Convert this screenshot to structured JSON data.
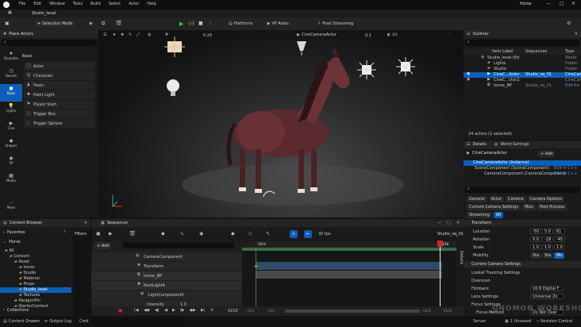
{
  "app": {
    "level_tab": "Studio_level",
    "project_name": "Horse",
    "menu": [
      "File",
      "Edit",
      "Window",
      "Tools",
      "Build",
      "Select",
      "Actor",
      "Help"
    ],
    "toolbar": {
      "mode": "Selection Mode",
      "platforms": "Platforms",
      "vp_roles": "VP Roles",
      "pixel_streaming": "Pixel Streaming"
    }
  },
  "place_actors": {
    "title": "Place Actors",
    "category_tab": "Basic",
    "categories": [
      "Favorites",
      "Recent",
      "Basic",
      "Lights",
      "Cine",
      "Shapes",
      "VP",
      "Media",
      "More"
    ],
    "items": [
      "Actor",
      "Character",
      "Pawn",
      "Point Light",
      "Player Start",
      "Trigger Box",
      "Trigger Sphere"
    ]
  },
  "viewport": {
    "actor_name": "CineCameraActor",
    "fov_value": "0.1",
    "lit_mode": "Lit",
    "snap_value": "0.25",
    "top_angle": "10°",
    "top_scale": "1"
  },
  "outliner": {
    "title": "Outliner",
    "col_label": "Item Label",
    "col_sequences": "Sequences",
    "col_type": "Type",
    "rows": [
      {
        "label": "Studio_level (Ed",
        "seq": "",
        "type": "World"
      },
      {
        "label": "Lights",
        "seq": "",
        "type": "Folder"
      },
      {
        "label": "Studio",
        "seq": "",
        "type": "Folder"
      },
      {
        "label": "CineC...Actor",
        "seq": "Studio_sq_01",
        "type": "CineCam"
      },
      {
        "label": "CineC...ctor2",
        "seq": "",
        "type": "CineCam"
      },
      {
        "label": "horse_BP",
        "seq": "Studio_sq_01",
        "type": "Edit ho"
      }
    ],
    "status": "24 actors (1 selected)"
  },
  "details": {
    "tab_details": "Details",
    "tab_world": "World Settings",
    "actor": "CineCameraActor",
    "add": "+ Add",
    "components": [
      {
        "label": "CineCameraActor (Instance)",
        "link": ""
      },
      {
        "label": "SceneComponent (SceneComponent)",
        "link": "Edit in C++"
      },
      {
        "label": "CameraComponent (CameraComponent)",
        "link": "Edit in C++"
      }
    ],
    "filter_tabs_row1": [
      "General",
      "Actor",
      "Camera",
      "Camera Options"
    ],
    "filter_tabs_row2": [
      "Current Camera Settings",
      "Misc",
      "Post Process"
    ],
    "filter_tabs_row3": [
      "Streaming",
      "All"
    ],
    "transform_title": "Transform",
    "transform": [
      {
        "label": "Location",
        "x": "-50",
        "y": "5.0",
        "z": "61"
      },
      {
        "label": "Rotation",
        "x": "0.0",
        "y": "-18",
        "z": "-45"
      },
      {
        "label": "Scale",
        "x": "1.0",
        "y": "1.0",
        "z": "1.0"
      }
    ],
    "mobility": {
      "label": "Mobility",
      "options": [
        "Sta",
        "Sta",
        "Mo"
      ]
    },
    "camera_section": "Current Camera Settings",
    "camera_props": [
      {
        "label": "Lookat Tracking Settings",
        "value": ""
      },
      {
        "label": "Overscan",
        "value": ""
      },
      {
        "label": "Filmback",
        "value": "16:9 Digital F"
      },
      {
        "label": "Lens Settings",
        "value": "Universal Zo"
      },
      {
        "label": "Focus Settings",
        "value": ""
      },
      {
        "label": "Focus Method",
        "value": "Do Not Over"
      }
    ]
  },
  "content_browser": {
    "title": "Content Browser",
    "favorites": "Favorites",
    "project": "Horse",
    "tree": [
      {
        "label": "All",
        "depth": 0
      },
      {
        "label": "Content",
        "depth": 1
      },
      {
        "label": "Asset",
        "depth": 2
      },
      {
        "label": "horse",
        "depth": 3
      },
      {
        "label": "Studio",
        "depth": 3
      },
      {
        "label": "Material",
        "depth": 3
      },
      {
        "label": "Props",
        "depth": 3
      },
      {
        "label": "Studio_level",
        "depth": 3
      },
      {
        "label": "Textures",
        "depth": 3
      },
      {
        "label": "ParagonFin",
        "depth": 2
      },
      {
        "label": "StarterContent",
        "depth": 2
      }
    ],
    "collections": "Collections",
    "filters": "Filters"
  },
  "sequencer": {
    "title": "Sequencer",
    "add": "+ Add",
    "fps": "30 fps",
    "sequence_name": "Studio_sq_01",
    "current_frame": "0210",
    "tracks": [
      {
        "label": "CameraComponent",
        "depth": 2
      },
      {
        "label": "Transform",
        "depth": 1
      },
      {
        "label": "horse_BP",
        "depth": 0
      },
      {
        "label": "RectLight4",
        "depth": 0
      },
      {
        "label": "LightComponent0",
        "depth": 1
      },
      {
        "label": "Intensity",
        "depth": 2
      }
    ],
    "intensity_value": "1.0",
    "ruler_start": "0000",
    "footer_frames": [
      "-015",
      "-015",
      "0210",
      "0235",
      "0235"
    ],
    "details_tab": "Details"
  },
  "bottom_bar": {
    "content_drawer": "Content Drawer",
    "output_log": "Output Log",
    "cmd": "Cmd",
    "server": "Server",
    "unsaved": "1 Unsaved",
    "revision": "Revision Control"
  },
  "watermark": "GNOMON WORKSHOP",
  "colors": {
    "accent": "#0b5fb8",
    "playhead": "#d9262c",
    "play": "#3fc43f"
  }
}
